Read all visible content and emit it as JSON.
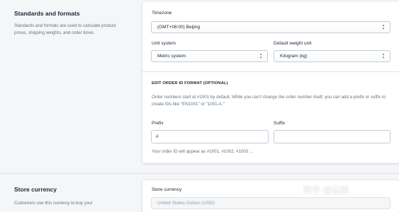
{
  "standards": {
    "title": "Standards and formats",
    "description": "Standards and formats are used to calculate product prices, shipping weights, and order times.",
    "timezone_label": "Timezone",
    "timezone_value": "(GMT+08:00) Beijing",
    "unit_system_label": "Unit system",
    "unit_system_value": "Metric system",
    "weight_unit_label": "Default weight unit",
    "weight_unit_value": "Kilogram (kg)",
    "order_id_heading": "EDIT ORDER ID FORMAT (OPTIONAL)",
    "order_id_help": "Order numbers start at #1001 by default. While you can’t change the order number itself, you can add a prefix or suffix to create IDs like \"EN1001\" or \"1001-A.\"",
    "prefix_label": "Prefix",
    "prefix_value": "#",
    "suffix_label": "Suffix",
    "suffix_value": "",
    "preview_text": "Your order ID will appear as #1001, #1002, #1003 ..."
  },
  "currency": {
    "title": "Store currency",
    "description": "Customers use this currency to buy your",
    "label": "Store currency",
    "value": "United States Dollars (USD)"
  },
  "watermark": "知乎 @云鹤"
}
